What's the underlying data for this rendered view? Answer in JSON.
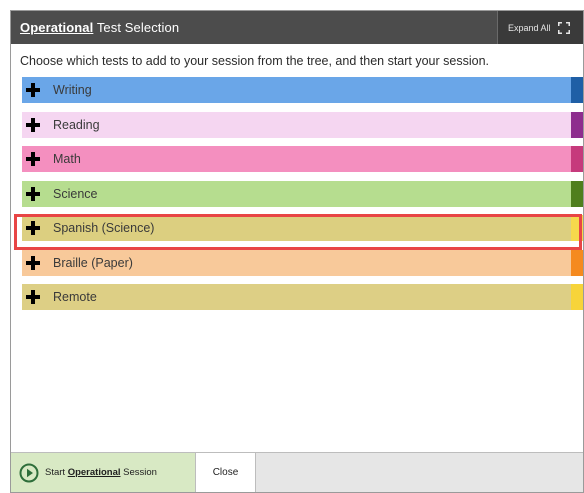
{
  "dialog": {
    "title_strong": "Operational",
    "title_rest": "Test Selection",
    "expand_all_label": "Expand All",
    "instructions": "Choose which tests to add to your session from the tree, and then start your session."
  },
  "tests": [
    {
      "label": "Writing",
      "bg": "#6aa6e8",
      "swatch": "#1f5fa6"
    },
    {
      "label": "Reading",
      "bg": "#f5d6f1",
      "swatch": "#8e2d8e"
    },
    {
      "label": "Math",
      "bg": "#f48fbf",
      "swatch": "#c63a7c"
    },
    {
      "label": "Science",
      "bg": "#b6dd8f",
      "swatch": "#4f7f1d"
    },
    {
      "label": "Spanish (Science)",
      "bg": "#dccf80",
      "swatch": "#f6d94c"
    },
    {
      "label": "Braille (Paper)",
      "bg": "#f8c99a",
      "swatch": "#f58a1f"
    },
    {
      "label": "Remote",
      "bg": "#ddcf85",
      "swatch": "#f7d43a"
    }
  ],
  "footer": {
    "start_prefix": "Start",
    "start_strong": "Operational",
    "start_suffix": "Session",
    "close_label": "Close"
  },
  "colors": {
    "title_bar": "#4c4c4c",
    "highlight": "#e84545",
    "start_button_bg": "#d8e9c4",
    "play_icon": "#2e6e3a"
  }
}
